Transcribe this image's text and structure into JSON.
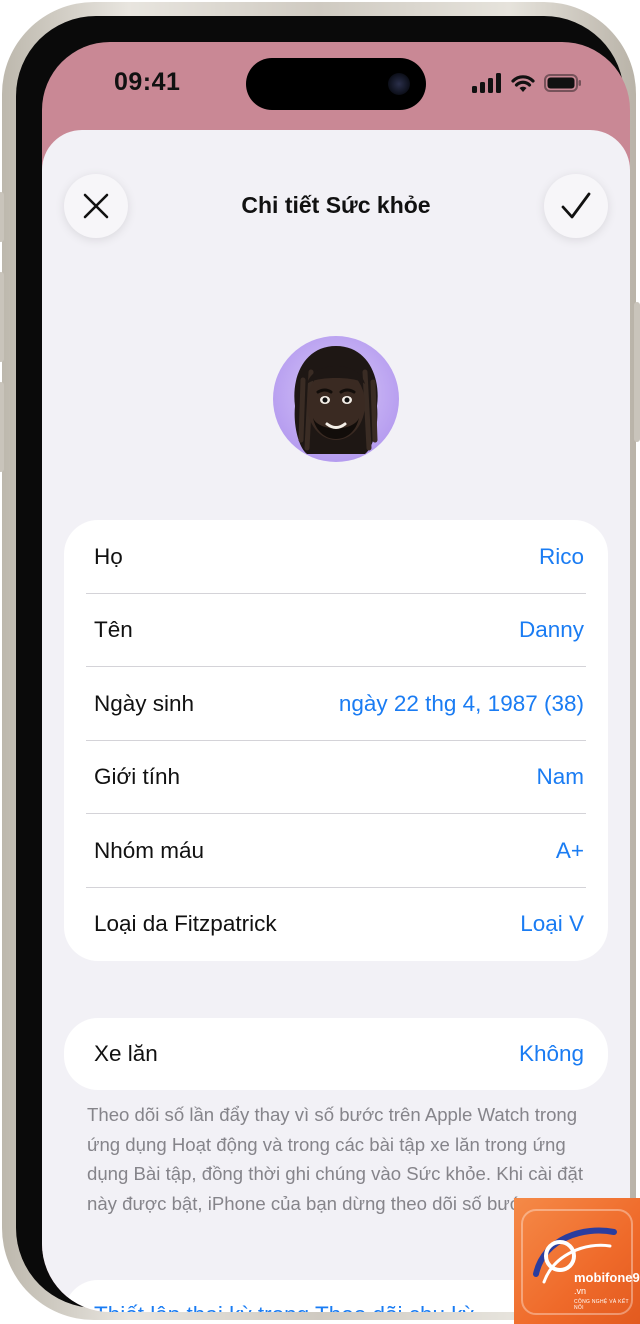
{
  "status_bar": {
    "time": "09:41",
    "icons": [
      "cellular-signal-icon",
      "wifi-icon",
      "battery-icon"
    ]
  },
  "header": {
    "title": "Chi tiết Sức khỏe",
    "close_icon": "close-icon",
    "done_icon": "checkmark-icon"
  },
  "profile": {
    "avatar": "memoji-avatar"
  },
  "details": [
    {
      "label": "Họ",
      "value": "Rico"
    },
    {
      "label": "Tên",
      "value": "Danny"
    },
    {
      "label": "Ngày sinh",
      "value": "ngày 22 thg 4, 1987 (38)"
    },
    {
      "label": "Giới tính",
      "value": "Nam"
    },
    {
      "label": "Nhóm máu",
      "value": "A+"
    },
    {
      "label": "Loại da Fitzpatrick",
      "value": "Loại V"
    }
  ],
  "wheelchair": {
    "label": "Xe lăn",
    "value": "Không",
    "note": "Theo dõi số lần đẩy thay vì số bước trên Apple Watch trong ứng dụng Hoạt động và trong các bài tập xe lăn trong ứng dụng Bài tập, đồng thời ghi chúng vào Sức khỏe. Khi cài đặt này được bật, iPhone của bạn dừng theo dõi số bước."
  },
  "bottom_link": "Thiết lập thai kỳ trong Theo dõi chu kỳ",
  "watermark": {
    "brand": "mobifone9",
    "domain": ".vn",
    "tagline": "CÔNG NGHỆ VÀ KẾT NỐI"
  },
  "colors": {
    "accent": "#1a7cf3",
    "wallpaper": "#c98895",
    "sheet_bg": "#f2f1f6",
    "watermark": "#ef6a2a"
  }
}
